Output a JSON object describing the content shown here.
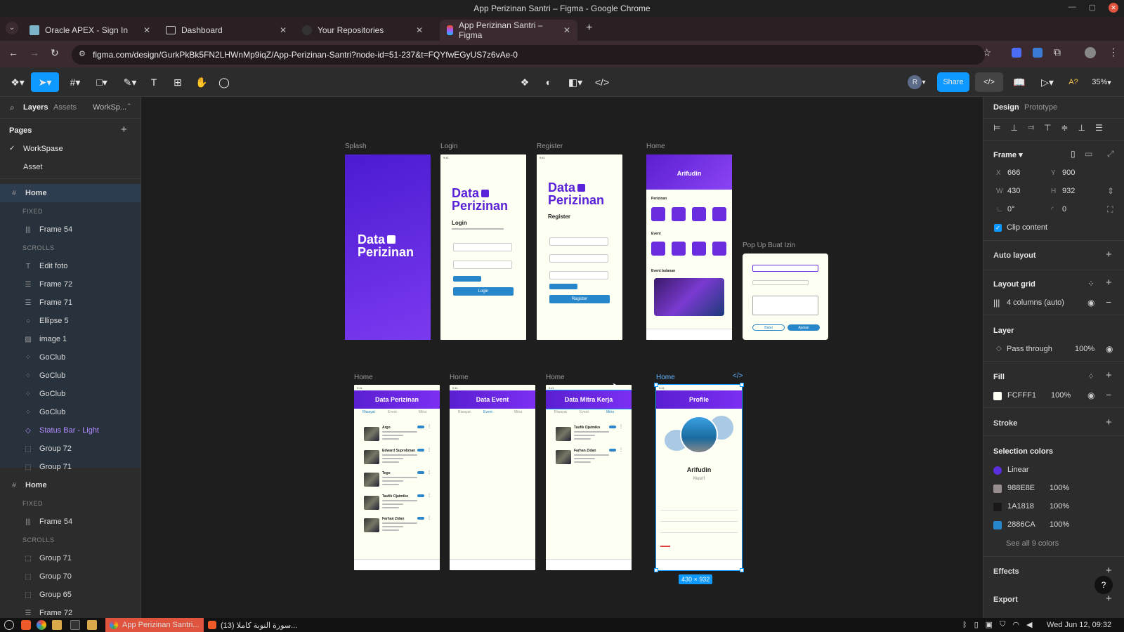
{
  "window": {
    "title": "App Perizinan Santri – Figma - Google Chrome"
  },
  "browser": {
    "tabs": [
      {
        "label": "Oracle APEX - Sign In"
      },
      {
        "label": "Dashboard"
      },
      {
        "label": "Your Repositories"
      },
      {
        "label": "App Perizinan Santri – Figma"
      }
    ],
    "url": "figma.com/design/GurkPkBk5FN2LHWnMp9iqZ/App-Perizinan-Santri?node-id=51-237&t=FQYfwEGyUS7z6vAe-0"
  },
  "toolbar": {
    "share_label": "Share",
    "zoom": "35%",
    "avatar_initial": "R"
  },
  "left_panel": {
    "tabs": {
      "layers": "Layers",
      "assets": "Assets",
      "workspace": "WorkSp..."
    },
    "pages_title": "Pages",
    "pages": [
      "WorkSpase",
      "Asset"
    ],
    "layers": [
      {
        "label": "Home",
        "kind": "frame-hash"
      },
      {
        "label": "FIXED",
        "kind": "section"
      },
      {
        "label": "Frame 54",
        "kind": "columns"
      },
      {
        "label": "SCROLLS",
        "kind": "section"
      },
      {
        "label": "Edit foto",
        "kind": "text"
      },
      {
        "label": "Frame 72",
        "kind": "rows"
      },
      {
        "label": "Frame 71",
        "kind": "rows"
      },
      {
        "label": "Ellipse 5",
        "kind": "ellipse"
      },
      {
        "label": "image 1",
        "kind": "image"
      },
      {
        "label": "GoClub",
        "kind": "grid"
      },
      {
        "label": "GoClub",
        "kind": "grid"
      },
      {
        "label": "GoClub",
        "kind": "grid"
      },
      {
        "label": "GoClub",
        "kind": "grid"
      },
      {
        "label": "Status Bar - Light",
        "kind": "component"
      },
      {
        "label": "Group 72",
        "kind": "group"
      },
      {
        "label": "Group 71",
        "kind": "group"
      },
      {
        "label": "Home",
        "kind": "frame-hash"
      },
      {
        "label": "FIXED",
        "kind": "section"
      },
      {
        "label": "Frame 54",
        "kind": "columns"
      },
      {
        "label": "SCROLLS",
        "kind": "section"
      },
      {
        "label": "Group 71",
        "kind": "group"
      },
      {
        "label": "Group 70",
        "kind": "group"
      },
      {
        "label": "Group 65",
        "kind": "group"
      },
      {
        "label": "Frame 72",
        "kind": "rows"
      }
    ]
  },
  "canvas": {
    "frame_labels": [
      "Splash",
      "Login",
      "Register",
      "Home",
      "Pop Up Buat Izin",
      "Home",
      "Home",
      "Home",
      "Home"
    ],
    "splash": {
      "logo_line1": "Data",
      "logo_line2": "Perizinan"
    },
    "login": {
      "logo_line1": "Data",
      "logo_line2": "Perizinan",
      "heading": "Login",
      "button": "Login"
    },
    "register": {
      "logo_line1": "Data",
      "logo_line2": "Perizinan",
      "heading": "Register",
      "button": "Register"
    },
    "home": {
      "name": "Arifudin",
      "section1": "Perizinan",
      "section2": "Event",
      "section3": "Event bulanan"
    },
    "popup": {
      "cancel": "Batal",
      "submit": "Ajukan"
    },
    "list_izin": {
      "header": "Data Perizinan",
      "tabs": [
        "Riwayat",
        "Event",
        "Mitra"
      ],
      "names": [
        "Argo",
        "Edward Suprobman",
        "Tego",
        "Taufik Ojatmiko",
        "Farhan Zidan"
      ]
    },
    "list_event": {
      "header": "Data Event",
      "tabs": [
        "Riwayat",
        "Event",
        "Mitra"
      ]
    },
    "list_mitra": {
      "header": "Data Mitra Kerja",
      "tabs": [
        "Riwayat",
        "Event",
        "Mitra"
      ],
      "names": [
        "Taufik Ojatmiko",
        "Farhan Zidan"
      ]
    },
    "profile": {
      "header": "Profile",
      "name": "Arifudin",
      "role": "Musrif"
    },
    "selection_size": "430 × 932"
  },
  "right_panel": {
    "tabs": {
      "design": "Design",
      "prototype": "Prototype"
    },
    "frame_label": "Frame",
    "x": "666",
    "y": "900",
    "w": "430",
    "h": "932",
    "rotation": "0°",
    "radius": "0",
    "clip_content": "Clip content",
    "auto_layout": "Auto layout",
    "layout_grid": "Layout grid",
    "grid_value": "4 columns (auto)",
    "layer": "Layer",
    "blend": "Pass through",
    "layer_opacity": "100%",
    "fill": "Fill",
    "fill_hex": "FCFFF1",
    "fill_opacity": "100%",
    "stroke": "Stroke",
    "selection_colors": "Selection colors",
    "colors": [
      {
        "name": "Linear",
        "color": "#5b2ee0",
        "opacity": ""
      },
      {
        "name": "988E8E",
        "color": "#988e8e",
        "opacity": "100%"
      },
      {
        "name": "1A1818",
        "color": "#1a1818",
        "opacity": "100%"
      },
      {
        "name": "2886CA",
        "color": "#2886ca",
        "opacity": "100%"
      }
    ],
    "see_all": "See all 9 colors",
    "effects": "Effects",
    "export": "Export"
  },
  "taskbar": {
    "app1": "App Perizinan Santri...",
    "app2": "سورة النوبة كاملا (13)...",
    "clock": "Wed Jun 12, 09:32"
  },
  "accent_colors": {
    "figma_blue": "#0d99ff",
    "purple": "#6b2de0",
    "fill": "#fcfff1"
  }
}
